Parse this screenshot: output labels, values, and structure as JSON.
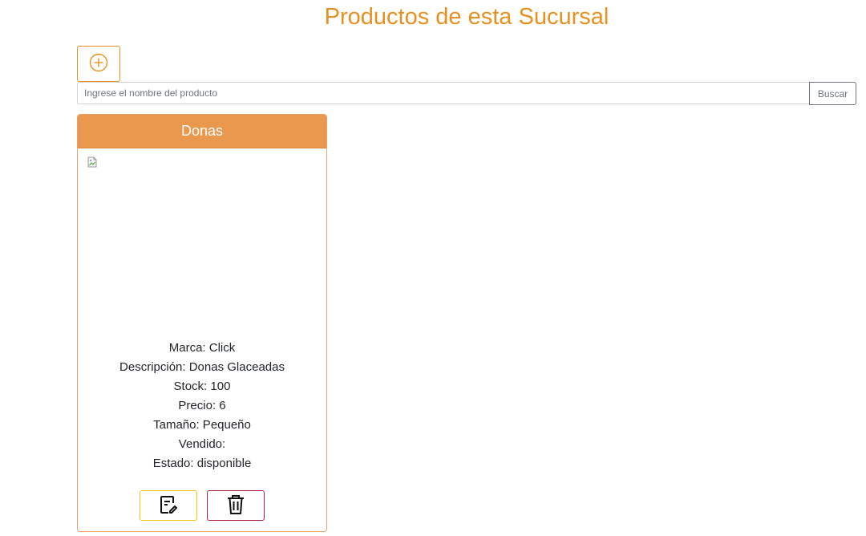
{
  "page": {
    "title": "Productos de esta Sucursal"
  },
  "toolbar": {
    "add_icon": "plus-circle-icon",
    "accent_color": "#e8901f"
  },
  "search": {
    "placeholder": "Ingrese el nombre del producto",
    "value": "",
    "button_label": "Buscar"
  },
  "products": [
    {
      "name": "Donas",
      "header_color": "#ea984e",
      "image": "broken-image-icon",
      "details": {
        "marca": "Marca: Click",
        "descripcion": "Descripción: Donas Glaceadas",
        "stock": "Stock: 100",
        "precio": "Precio: 6",
        "tamano": "Tamaño: Pequeño",
        "vendido": "Vendido:",
        "estado": "Estado: disponible"
      },
      "actions": {
        "edit_icon": "edit-document-icon",
        "delete_icon": "trash-icon",
        "edit_color": "#f2c811",
        "delete_color": "#b0203c"
      }
    }
  ]
}
